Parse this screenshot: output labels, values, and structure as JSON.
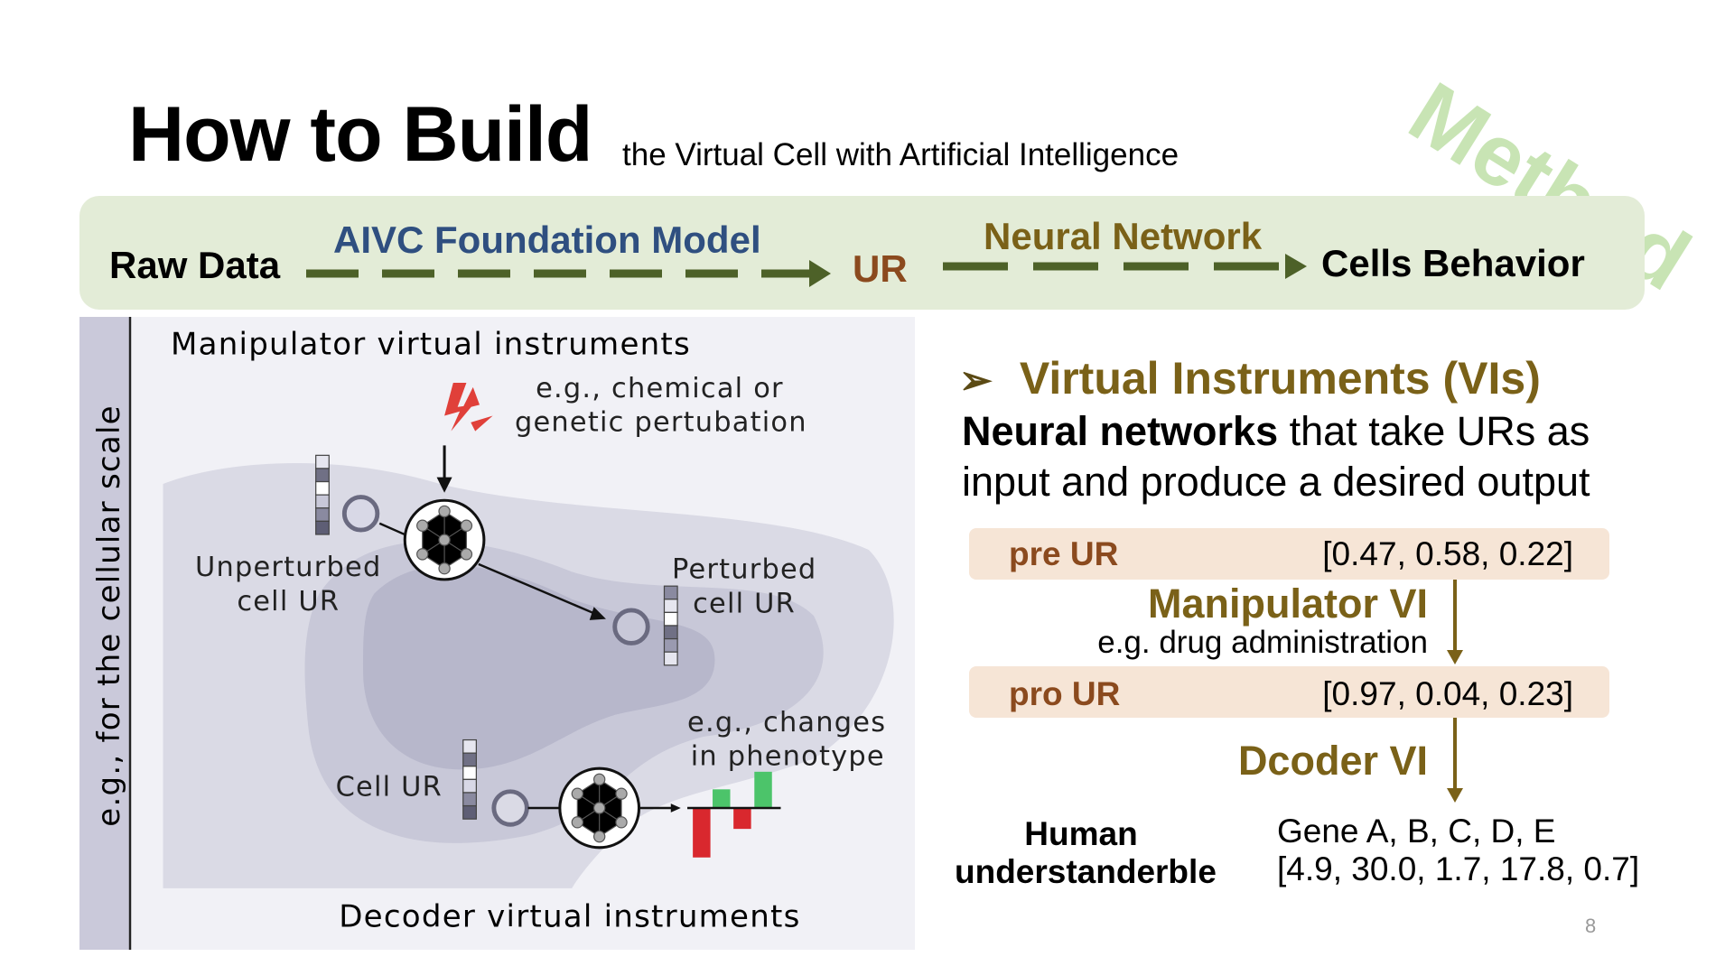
{
  "watermark": "Method",
  "title": {
    "main": "How to Build",
    "sub": "the Virtual Cell with Artificial Intelligence"
  },
  "pipeline": {
    "raw_data": "Raw Data",
    "foundation_model": "AIVC Foundation Model",
    "ur": "UR",
    "neural_network": "Neural Network",
    "cells_behavior": "Cells Behavior"
  },
  "figure": {
    "side_label": "e.g., for the cellular scale",
    "manipulator_title": "Manipulator virtual instruments",
    "perturbation_line1": "e.g., chemical or",
    "perturbation_line2": "genetic pertubation",
    "unperturbed_line1": "Unperturbed",
    "unperturbed_line2": "cell UR",
    "perturbed_line1": "Perturbed",
    "perturbed_line2": "cell UR",
    "phenotype_line1": "e.g., changes",
    "phenotype_line2": "in phenotype",
    "cell_ur": "Cell UR",
    "decoder_title": "Decoder virtual instruments"
  },
  "vis": {
    "heading": "Virtual Instruments (VIs)",
    "bullet_icon": "arrowhead-bullet",
    "desc_bold": "Neural networks",
    "desc_rest": " that take URs as",
    "desc_line2": "input and produce a desired output",
    "pre_ur_label": "pre UR",
    "pre_ur_value": "[0.47, 0.58, 0.22]",
    "manipulator_vi": "Manipulator VI",
    "manipulator_example": "e.g. drug administration",
    "pro_ur_label": "pro UR",
    "pro_ur_value": "[0.97, 0.04, 0.23]",
    "decoder_vi": "Dcoder VI",
    "human_line1": "Human",
    "human_line2": "understanderble",
    "genes": "Gene A, B, C, D, E",
    "gene_values": "[4.9, 30.0, 1.7, 17.8, 0.7]"
  },
  "page_number": "8",
  "colors": {
    "banner": "#e3ecd7",
    "foundation": "#2f4f80",
    "ur": "#8b4a1e",
    "network": "#7a6118",
    "arrow": "#4d6128",
    "ur_box": "#f6e5d6",
    "watermark": "#bfe0a8"
  }
}
